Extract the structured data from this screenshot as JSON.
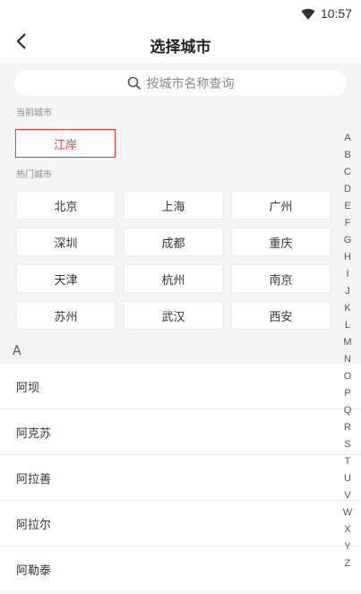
{
  "status_bar": {
    "time": "10:57",
    "icons": [
      "wifi-icon"
    ]
  },
  "header": {
    "title": "选择城市",
    "back_icon": "chevron-left-icon"
  },
  "search": {
    "placeholder": "按城市名称查询",
    "icon": "search-icon"
  },
  "current_section": {
    "label": "当前城市",
    "city": "江岸"
  },
  "hot_section": {
    "label": "热门城市",
    "cities": [
      "北京",
      "上海",
      "广州",
      "深圳",
      "成都",
      "重庆",
      "天津",
      "杭州",
      "南京",
      "苏州",
      "武汉",
      "西安"
    ]
  },
  "list": {
    "header": "A",
    "cities": [
      "阿坝",
      "阿克苏",
      "阿拉善",
      "阿拉尔",
      "阿勒泰"
    ]
  },
  "index_bar": {
    "letters": [
      "A",
      "B",
      "C",
      "D",
      "E",
      "F",
      "G",
      "H",
      "I",
      "J",
      "K",
      "L",
      "M",
      "N",
      "O",
      "P",
      "Q",
      "R",
      "S",
      "T",
      "U",
      "V",
      "W",
      "X",
      "Y",
      "Z"
    ]
  },
  "colors": {
    "accent": "#d9413a",
    "background": "#f4f4f6",
    "surface": "#ffffff"
  }
}
